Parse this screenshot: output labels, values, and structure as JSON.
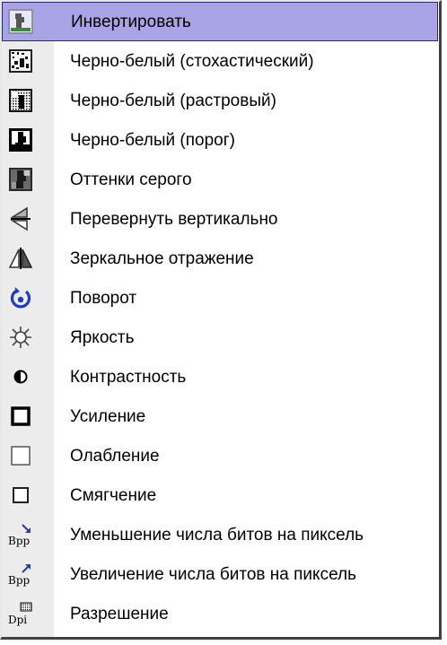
{
  "menu": {
    "items": [
      {
        "label": "Инвертировать",
        "icon": "invert-icon",
        "selected": true
      },
      {
        "label": "Черно-белый (стохастический)",
        "icon": "bw-stochastic-icon"
      },
      {
        "label": "Черно-белый (растровый)",
        "icon": "bw-raster-icon"
      },
      {
        "label": "Черно-белый (порог)",
        "icon": "bw-threshold-icon"
      },
      {
        "label": "Оттенки серого",
        "icon": "grayscale-icon"
      },
      {
        "label": "Перевернуть вертикально",
        "icon": "flip-vertical-icon"
      },
      {
        "label": "Зеркальное отражение",
        "icon": "mirror-icon"
      },
      {
        "label": "Поворот",
        "icon": "rotate-icon"
      },
      {
        "label": "Яркость",
        "icon": "brightness-icon"
      },
      {
        "label": "Контрастность",
        "icon": "contrast-icon"
      },
      {
        "label": "Усиление",
        "icon": "sharpen-icon"
      },
      {
        "label": "Олабление",
        "icon": "weaken-icon"
      },
      {
        "label": "Смягчение",
        "icon": "soften-icon"
      },
      {
        "label": "Уменьшение числа битов на пиксель",
        "icon": "bpp-decrease-icon"
      },
      {
        "label": "Увеличение числа битов на пиксель",
        "icon": "bpp-increase-icon"
      },
      {
        "label": "Разрешение",
        "icon": "dpi-icon"
      }
    ]
  },
  "colors": {
    "selection_bg": "#a8a4e6",
    "selection_border": "#2a2a6e",
    "rotate_icon": "#1f3bc4"
  }
}
